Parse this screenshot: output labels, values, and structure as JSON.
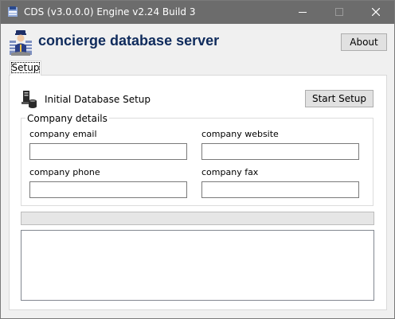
{
  "window": {
    "title": "CDS (v3.0.0.0) Engine v2.24 Build 3",
    "titlebar_color": "#6c6c6c"
  },
  "header": {
    "app_title": "concierge database server",
    "about_label": "About",
    "logo_icon": "concierge-server-icon",
    "title_color": "#0f2b5c"
  },
  "tabs": [
    {
      "label": "Setup",
      "active": true
    }
  ],
  "setup": {
    "section_label": "Initial Database Setup",
    "section_icon": "database-setup-icon",
    "start_label": "Start Setup",
    "group_title": "Company details",
    "fields": {
      "email": {
        "label": "company email",
        "value": "",
        "placeholder": ""
      },
      "website": {
        "label": "company website",
        "value": "",
        "placeholder": ""
      },
      "phone": {
        "label": "company phone",
        "value": "",
        "placeholder": ""
      },
      "fax": {
        "label": "company fax",
        "value": "",
        "placeholder": ""
      }
    },
    "progress_fraction": 0,
    "log_text": ""
  }
}
